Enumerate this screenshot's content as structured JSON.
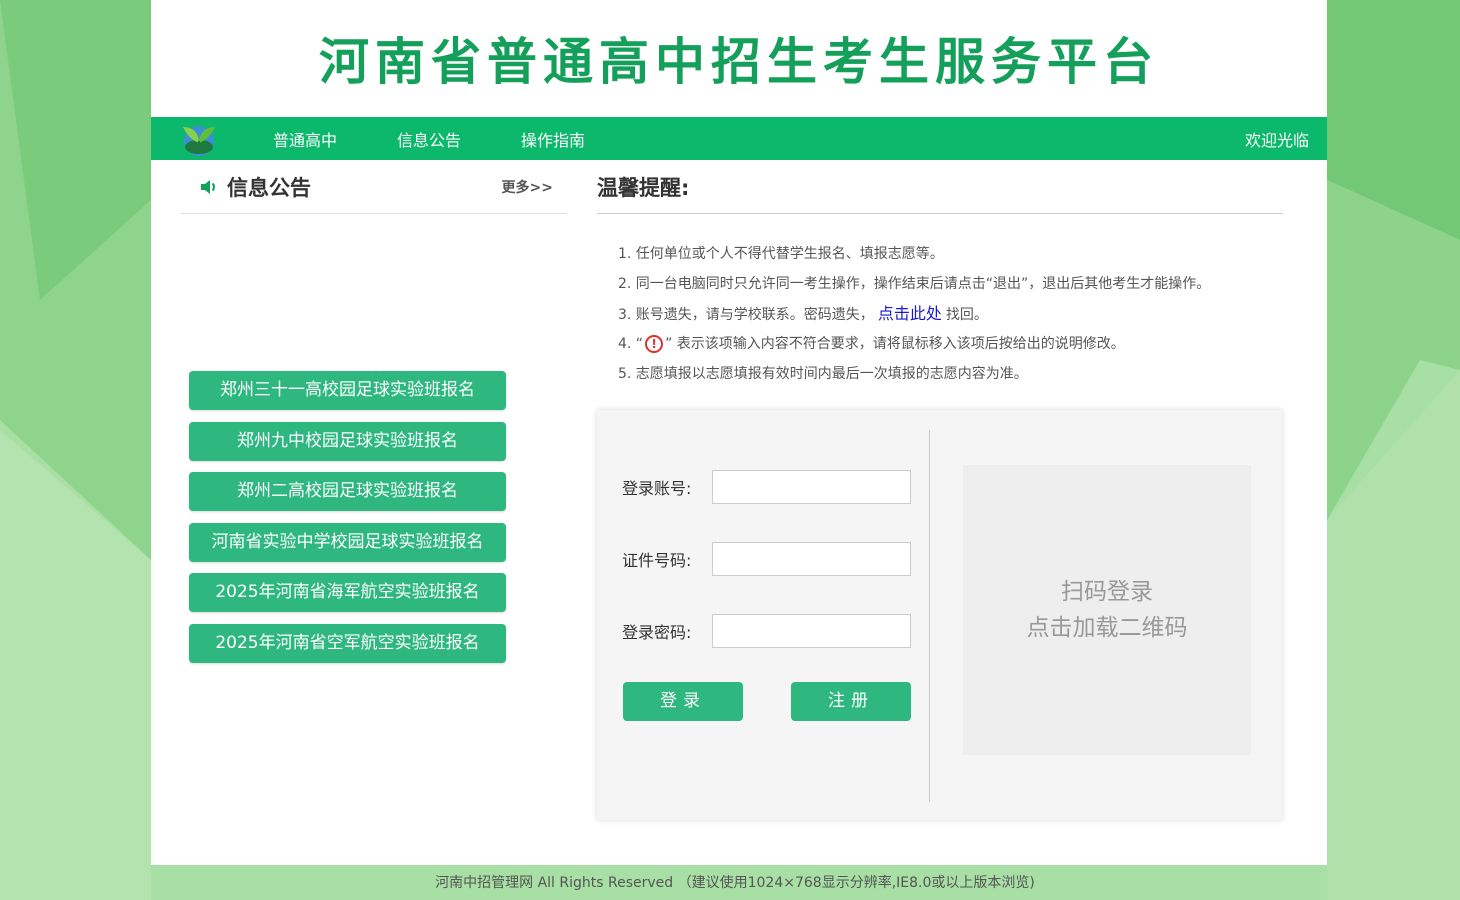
{
  "header": {
    "title": "河南省普通高中招生考生服务平台"
  },
  "nav": {
    "items": [
      {
        "label": "普通高中"
      },
      {
        "label": "信息公告"
      },
      {
        "label": "操作指南"
      }
    ],
    "welcome": "欢迎光临"
  },
  "news_panel": {
    "title": "信息公告",
    "more": "更多>>",
    "buttons": [
      {
        "label": "郑州三十一高校园足球实验班报名"
      },
      {
        "label": "郑州九中校园足球实验班报名"
      },
      {
        "label": "郑州二高校园足球实验班报名"
      },
      {
        "label": "河南省实验中学校园足球实验班报名"
      },
      {
        "label": "2025年河南省海军航空实验班报名"
      },
      {
        "label": "2025年河南省空军航空实验班报名"
      }
    ]
  },
  "tips": {
    "title": "温馨提醒:",
    "line1": "1. 任何单位或个人不得代替学生报名、填报志愿等。",
    "line2": "2. 同一台电脑同时只允许同一考生操作，操作结束后请点击“退出”，退出后其他考生才能操作。",
    "line3_pre": "3. 账号遗失，请与学校联系。密码遗失，",
    "line3_link": "点击此处",
    "line3_post": "找回。",
    "line4_pre": "4.  “",
    "line4_icon": "!",
    "line4_post": "” 表示该项输入内容不符合要求，请将鼠标移入该项后按给出的说明修改。",
    "line5": "5. 志愿填报以志愿填报有效时间内最后一次填报的志愿内容为准。"
  },
  "login": {
    "account_label": "登录账号:",
    "account_value": "",
    "id_label": "证件号码:",
    "id_value": "",
    "password_label": "登录密码:",
    "password_value": "",
    "login_button": "登录",
    "register_button": "注册",
    "qr_line1": "扫码登录",
    "qr_line2": "点击加载二维码"
  },
  "footer": {
    "text": "河南中招管理网 All Rights Reserved （建议使用1024×768显示分辨率,IE8.0或以上版本浏览)"
  },
  "colors": {
    "brand": "#0bb86c",
    "button": "#2eb77f",
    "title": "#14a05a",
    "background": "#a8dfa4"
  }
}
